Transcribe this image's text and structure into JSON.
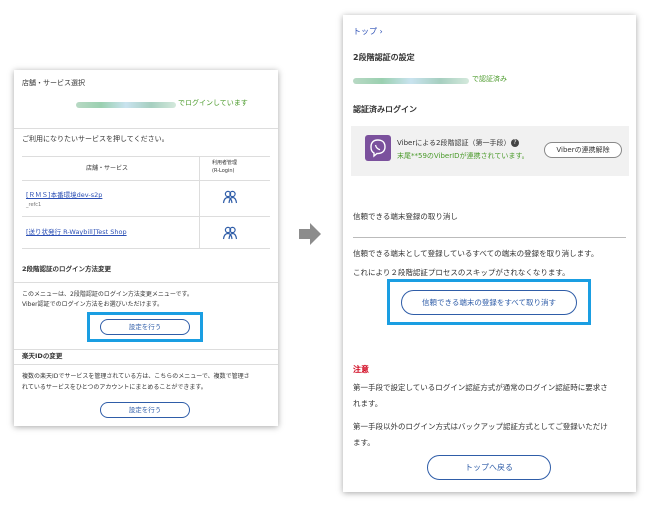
{
  "left_panel": {
    "section_title": "店舗・サービス選択",
    "login_status": "でログインしています",
    "instruction": "ご利用になりたいサービスを押してください。",
    "table": {
      "header_service": "店舗・サービス",
      "header_admin_line1": "利用者管理",
      "header_admin_line2": "(R-Login)",
      "rows": [
        {
          "service": "[ＲＭＳ]本番環境dev-s2p",
          "sub": "_refc1",
          "icon": "people-icon"
        },
        {
          "service": "[送り状発行 R-Waybill]Test Shop",
          "sub": "",
          "icon": "people-icon"
        }
      ]
    },
    "twofa_title": "2段階認証のログイン方法変更",
    "twofa_desc_line1": "このメニューは、2段階認証のログイン方法変更メニューです。",
    "twofa_desc_line2": "Viber認証でのログイン方法をお選びいただけます。",
    "twofa_button": "設定を行う",
    "rakuten_title": "楽天IDの変更",
    "rakuten_desc_line1": "複数の楽天IDでサービスを管理されている方は、こちらのメニューで、複数で管理さ",
    "rakuten_desc_line2": "れているサービスをひとつのアカウントにまとめることができます。",
    "rakuten_button": "設定を行う"
  },
  "right_panel": {
    "breadcrumb": "トップ ›",
    "page_title": "2段階認証の設定",
    "auth_status": "で認証済み",
    "authed_login_title": "認証済みログイン",
    "viber_method": "Viberによる2段階認証（第一手段）",
    "viber_linked": "末尾**59のViberIDが連携されています。",
    "viber_unlink_button": "Viberの連携解除",
    "trusted_title": "信頼できる端末登録の取り消し",
    "trusted_desc1": "信頼できる端末として登録しているすべての端末の登録を取り消します。",
    "trusted_desc2": "これにより２段階認証プロセスのスキップがされなくなります。",
    "revoke_button": "信頼できる端末の登録をすべて取り消す",
    "note_title": "注意",
    "note1_line1": "第一手段で設定しているログイン認証方式が通常のログイン認証時に要求さ",
    "note1_line2": "れます。",
    "note2_line1": "第一手段以外のログイン方式はバックアップ認証方式としてご登録いただけ",
    "note2_line2": "ます。",
    "back_button": "トップへ戻る"
  },
  "colors": {
    "highlight": "#1a9ee2",
    "link": "#2b4fb5",
    "success": "#4a9a2a",
    "warning": "#d0021b",
    "viber": "#7b519d",
    "arrow": "#8c8c8c"
  }
}
